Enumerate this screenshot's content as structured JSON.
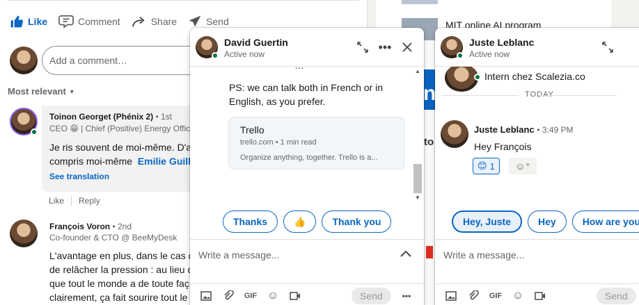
{
  "feed": {
    "actions": [
      {
        "label": "Like",
        "icon": "thumbs-up-icon"
      },
      {
        "label": "Comment",
        "icon": "comment-icon"
      },
      {
        "label": "Share",
        "icon": "share-arrow-icon"
      },
      {
        "label": "Send",
        "icon": "paper-plane-icon"
      }
    ],
    "comment_placeholder": "Add a comment…",
    "sort_label": "Most relevant",
    "comments": [
      {
        "name": "Toinon Georget (Phénix 2)",
        "degree": "• 1st",
        "headline": "CEO 😁 | Chief (Positive) Energy Office",
        "text_line1": "Je ris souvent de moi-même. D'a",
        "text_line2_prefix": "compris moi-même",
        "mention": "Emilie Guill",
        "see_translation": "See translation",
        "like": "Like",
        "reply": "Reply"
      },
      {
        "name": "François Voron",
        "degree": "• 2nd",
        "headline": "Co-founder & CTO @ BeeMyDesk",
        "lines": [
          "L'avantage en plus, dans le cas d'",
          "de relâcher la pression : au lieu d",
          "que tout le monde a de toute faç",
          "clairement, ça fait sourire tout le"
        ]
      }
    ]
  },
  "news": {
    "items": [
      {
        "text": "MIT online AI program"
      }
    ],
    "fragments": [
      "n",
      "to"
    ]
  },
  "chat1": {
    "name": "David Guertin",
    "status": "Active now",
    "message": "PS: we can talk both in French or in English, as you prefer.",
    "link_card": {
      "title": "Trello",
      "meta": "trello.com • 1 min read",
      "description": "Organize anything, together. Trello is a..."
    },
    "smart_replies": [
      "Thanks",
      "👍",
      "Thank you"
    ],
    "compose_placeholder": "Write a message...",
    "send_label": "Send",
    "toolbar": [
      "image-icon",
      "attachment-icon",
      "gif-icon",
      "emoji-icon",
      "video-icon"
    ],
    "gif_label": "GIF"
  },
  "chat2": {
    "name": "Juste Leblanc",
    "status": "Active now",
    "pinned_headline": "Intern chez Scalezia.co",
    "divider": "TODAY",
    "message_author": "Juste Leblanc",
    "message_time": "• 3:49 PM",
    "message_text": "Hey François",
    "reaction_emoji": "😊",
    "reaction_count": "1",
    "smart_replies": [
      "Hey, Juste",
      "Hey",
      "How are you?"
    ],
    "compose_placeholder": "Write a message...",
    "send_label": "Send",
    "gif_label": "GIF"
  },
  "colors": {
    "brand_blue": "#0a66c2",
    "online_green": "#057642",
    "pill_highlight": "#e8f1fa"
  }
}
